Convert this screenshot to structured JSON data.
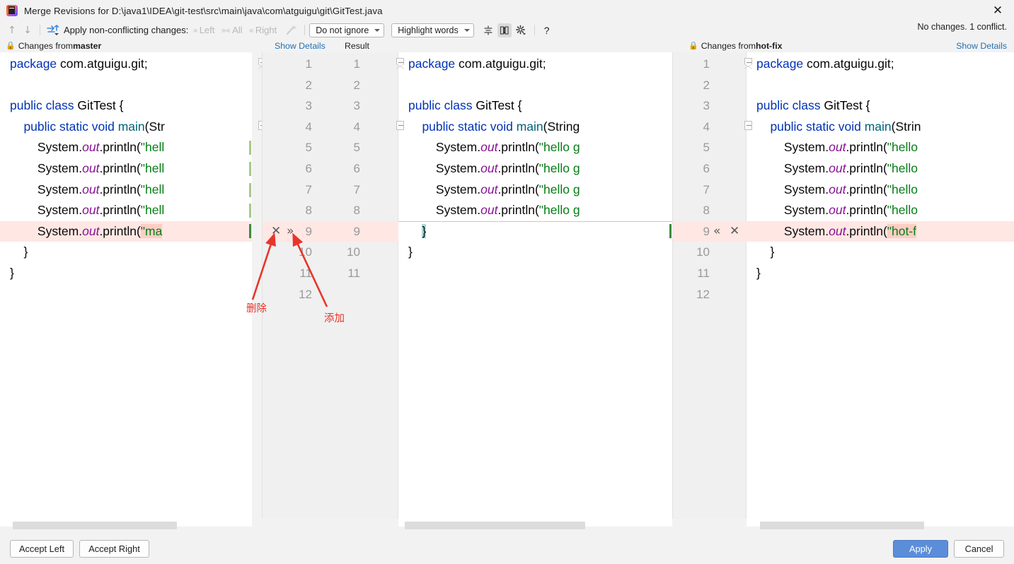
{
  "window": {
    "title": "Merge Revisions for D:\\java1\\IDEA\\git-test\\src\\main\\java\\com\\atguigu\\git\\GitTest.java",
    "logo_icon": "intellij-idea-logo",
    "close_icon": "close-icon"
  },
  "toolbar": {
    "prev_icon": "arrow-up-icon",
    "next_icon": "arrow-down-icon",
    "apply_all_icon": "apply-non-conflicting-icon",
    "apply_label": "Apply non-conflicting changes:",
    "left_label": "Left",
    "left_icon": "chevron-right-double-icon",
    "all_label": "All",
    "all_icon": "chevron-both-icon",
    "right_label": "Right",
    "right_icon": "chevron-left-double-icon",
    "magic_icon": "magic-resolve-icon",
    "ignore_select": "Do not ignore",
    "highlight_select": "Highlight words",
    "collapse_icon": "collapse-unchanged-icon",
    "sync_scroll_icon": "synchronize-scroll-icon",
    "settings_icon": "gear-icon",
    "help_icon": "help-question-icon",
    "status": "No changes. 1 conflict.",
    "show_details_right": "Show Details"
  },
  "headers": {
    "left": {
      "lock_icon": "lock-icon",
      "prefix": "Changes from ",
      "branch": "master"
    },
    "center": {
      "show_details": "Show Details",
      "result": "Result"
    },
    "right": {
      "lock_icon": "lock-icon",
      "prefix": "Changes from ",
      "branch": "hot-fix"
    }
  },
  "left_pane": {
    "name": "master",
    "lines": [
      [
        {
          "t": "package ",
          "c": "kw"
        },
        {
          "t": "com.atguigu.git;",
          "c": "pl"
        }
      ],
      [],
      [
        {
          "t": "public class ",
          "c": "kw"
        },
        {
          "t": "GitTest {",
          "c": "cls"
        }
      ],
      [
        {
          "t": "    ",
          "c": "pl"
        },
        {
          "t": "public static void ",
          "c": "kw"
        },
        {
          "t": "main",
          "c": "fn"
        },
        {
          "t": "(Str",
          "c": "pl"
        }
      ],
      [
        {
          "t": "        System.",
          "c": "pl"
        },
        {
          "t": "out",
          "c": "fld"
        },
        {
          "t": ".println(",
          "c": "pl"
        },
        {
          "t": "\"hell",
          "c": "str"
        }
      ],
      [
        {
          "t": "        System.",
          "c": "pl"
        },
        {
          "t": "out",
          "c": "fld"
        },
        {
          "t": ".println(",
          "c": "pl"
        },
        {
          "t": "\"hell",
          "c": "str"
        }
      ],
      [
        {
          "t": "        System.",
          "c": "pl"
        },
        {
          "t": "out",
          "c": "fld"
        },
        {
          "t": ".println(",
          "c": "pl"
        },
        {
          "t": "\"hell",
          "c": "str"
        }
      ],
      [
        {
          "t": "        System.",
          "c": "pl"
        },
        {
          "t": "out",
          "c": "fld"
        },
        {
          "t": ".println(",
          "c": "pl"
        },
        {
          "t": "\"hell",
          "c": "str"
        }
      ],
      [
        {
          "t": "        System.",
          "c": "pl"
        },
        {
          "t": "out",
          "c": "fld"
        },
        {
          "t": ".println(",
          "c": "pl"
        },
        {
          "t": "\"ma",
          "c": "str hl"
        }
      ],
      [
        {
          "t": "    }",
          "c": "pl"
        }
      ],
      [
        {
          "t": "}",
          "c": "pl"
        }
      ]
    ],
    "conflict_line_index": 8
  },
  "center_pane": {
    "name": "Result",
    "lines": [
      [
        {
          "t": "package ",
          "c": "kw"
        },
        {
          "t": "com.atguigu.git;",
          "c": "pl"
        }
      ],
      [],
      [
        {
          "t": "public class ",
          "c": "kw"
        },
        {
          "t": "GitTest {",
          "c": "cls"
        }
      ],
      [
        {
          "t": "    ",
          "c": "pl"
        },
        {
          "t": "public static void ",
          "c": "kw"
        },
        {
          "t": "main",
          "c": "fn"
        },
        {
          "t": "(String",
          "c": "pl"
        }
      ],
      [
        {
          "t": "        System.",
          "c": "pl"
        },
        {
          "t": "out",
          "c": "fld"
        },
        {
          "t": ".println(",
          "c": "pl"
        },
        {
          "t": "\"hello g",
          "c": "str"
        }
      ],
      [
        {
          "t": "        System.",
          "c": "pl"
        },
        {
          "t": "out",
          "c": "fld"
        },
        {
          "t": ".println(",
          "c": "pl"
        },
        {
          "t": "\"hello g",
          "c": "str"
        }
      ],
      [
        {
          "t": "        System.",
          "c": "pl"
        },
        {
          "t": "out",
          "c": "fld"
        },
        {
          "t": ".println(",
          "c": "pl"
        },
        {
          "t": "\"hello g",
          "c": "str"
        }
      ],
      [
        {
          "t": "        System.",
          "c": "pl"
        },
        {
          "t": "out",
          "c": "fld"
        },
        {
          "t": ".println(",
          "c": "pl"
        },
        {
          "t": "\"hello g",
          "c": "str"
        }
      ],
      [
        {
          "t": "    ",
          "c": "pl"
        },
        {
          "t": "}",
          "c": "pl caret"
        }
      ],
      [
        {
          "t": "}",
          "c": "pl"
        }
      ]
    ],
    "conflict_line_index": 8,
    "caret_text": "}"
  },
  "right_pane": {
    "name": "hot-fix",
    "lines": [
      [
        {
          "t": "package ",
          "c": "kw"
        },
        {
          "t": "com.atguigu.git;",
          "c": "pl"
        }
      ],
      [],
      [
        {
          "t": "public class ",
          "c": "kw"
        },
        {
          "t": "GitTest {",
          "c": "cls"
        }
      ],
      [
        {
          "t": "    ",
          "c": "pl"
        },
        {
          "t": "public static void ",
          "c": "kw"
        },
        {
          "t": "main",
          "c": "fn"
        },
        {
          "t": "(Strin",
          "c": "pl"
        }
      ],
      [
        {
          "t": "        System.",
          "c": "pl"
        },
        {
          "t": "out",
          "c": "fld"
        },
        {
          "t": ".println(",
          "c": "pl"
        },
        {
          "t": "\"hello",
          "c": "str"
        }
      ],
      [
        {
          "t": "        System.",
          "c": "pl"
        },
        {
          "t": "out",
          "c": "fld"
        },
        {
          "t": ".println(",
          "c": "pl"
        },
        {
          "t": "\"hello",
          "c": "str"
        }
      ],
      [
        {
          "t": "        System.",
          "c": "pl"
        },
        {
          "t": "out",
          "c": "fld"
        },
        {
          "t": ".println(",
          "c": "pl"
        },
        {
          "t": "\"hello",
          "c": "str"
        }
      ],
      [
        {
          "t": "        System.",
          "c": "pl"
        },
        {
          "t": "out",
          "c": "fld"
        },
        {
          "t": ".println(",
          "c": "pl"
        },
        {
          "t": "\"hello",
          "c": "str"
        }
      ],
      [
        {
          "t": "        System.",
          "c": "pl"
        },
        {
          "t": "out",
          "c": "fld"
        },
        {
          "t": ".println(",
          "c": "pl"
        },
        {
          "t": "\"hot-f",
          "c": "str hl"
        }
      ],
      [
        {
          "t": "    }",
          "c": "pl"
        }
      ],
      [
        {
          "t": "}",
          "c": "pl"
        }
      ]
    ],
    "conflict_line_index": 8
  },
  "gutter_center": {
    "left_numbers": [
      "1",
      "2",
      "3",
      "4",
      "5",
      "6",
      "7",
      "8",
      "9",
      "10",
      "11",
      "12"
    ],
    "right_numbers": [
      "1",
      "2",
      "3",
      "4",
      "5",
      "6",
      "7",
      "8",
      "9",
      "10",
      "11"
    ],
    "conflict_row": 8,
    "accept_icon": "accept-right-chevrons-icon",
    "reject_icon": "reject-x-icon"
  },
  "gutter_right": {
    "numbers": [
      "1",
      "2",
      "3",
      "4",
      "5",
      "6",
      "7",
      "8",
      "9",
      "10",
      "11",
      "12"
    ],
    "conflict_row": 8,
    "accept_icon": "accept-left-chevrons-icon",
    "reject_icon": "reject-x-icon"
  },
  "annotations": [
    {
      "text": "删除",
      "meaning": "delete",
      "color": "#e8352b"
    },
    {
      "text": "添加",
      "meaning": "add",
      "color": "#e8352b"
    }
  ],
  "footer": {
    "accept_left": "Accept Left",
    "accept_right": "Accept Right",
    "apply": "Apply",
    "cancel": "Cancel"
  },
  "colors": {
    "conflict_bg": "#ffe7e4",
    "conflict_token": "#ffcdc4",
    "caret_selection": "#a8d8d8",
    "link": "#2470b3",
    "primary_button": "#5b8dd9",
    "annotation": "#e8352b"
  }
}
